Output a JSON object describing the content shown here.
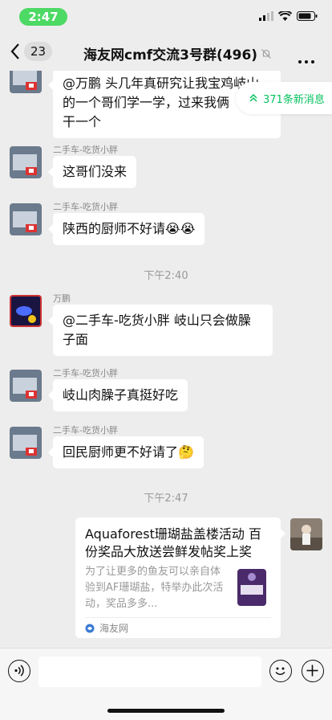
{
  "status_bar": {
    "time": "2:47"
  },
  "nav": {
    "unread_count": "23",
    "title": "海友网cmf交流3号群(496)"
  },
  "new_messages_pill": "371条新消息",
  "messages": [
    {
      "sender": "",
      "text_lines": [
        "@万鹏 头几年真研究让我宝鸡岐山",
        "的一个哥们学一学，过来我俩",
        "干一个"
      ]
    },
    {
      "sender": "二手车-吃货小胖",
      "text": "这哥们没来"
    },
    {
      "sender": "二手车-吃货小胖",
      "text": "陕西的厨师不好请😭😭"
    },
    {
      "sender": "万鹏",
      "text_lines": [
        "@二手车-吃货小胖 岐山只会做臊",
        "子面"
      ]
    },
    {
      "sender": "二手车-吃货小胖",
      "text": "岐山肉臊子真挺好吃"
    },
    {
      "sender": "二手车-吃货小胖",
      "text": "回民厨师更不好请了🤔"
    }
  ],
  "timestamps": [
    "下午2:40",
    "下午2:47"
  ],
  "card": {
    "title": "Aquaforest珊瑚盐盖楼活动 百份奖品大放送尝鲜发帖奖上奖",
    "desc": "为了让更多的鱼友可以亲自体验到AF珊瑚盐，特举办此次活动，奖品多多...",
    "source": "海友网"
  },
  "colors": {
    "accent": "#07c160",
    "time_pill": "#4cd964",
    "background": "#ededed"
  }
}
